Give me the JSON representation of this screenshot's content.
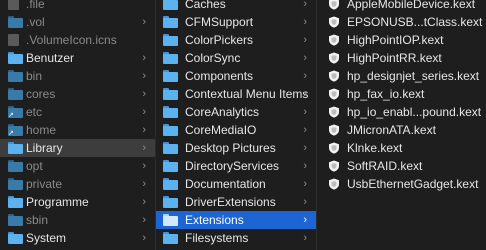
{
  "column1": [
    {
      "label": ".file",
      "dim": true,
      "icon": "document-icon",
      "chevron": false
    },
    {
      "label": ".vol",
      "dim": true,
      "icon": "folder-icon",
      "chevron": true
    },
    {
      "label": ".VolumeIcon.icns",
      "dim": true,
      "icon": "document-icon",
      "chevron": false
    },
    {
      "label": "Benutzer",
      "dim": false,
      "icon": "folder-icon",
      "chevron": true
    },
    {
      "label": "bin",
      "dim": true,
      "icon": "folder-icon",
      "chevron": true
    },
    {
      "label": "cores",
      "dim": true,
      "icon": "folder-icon",
      "chevron": true
    },
    {
      "label": "etc",
      "dim": true,
      "icon": "alias-folder-icon",
      "chevron": true
    },
    {
      "label": "home",
      "dim": true,
      "icon": "alias-folder-icon",
      "chevron": true
    },
    {
      "label": "Library",
      "dim": false,
      "icon": "folder-icon",
      "chevron": true,
      "selected": true
    },
    {
      "label": "opt",
      "dim": true,
      "icon": "folder-icon",
      "chevron": true
    },
    {
      "label": "private",
      "dim": true,
      "icon": "folder-icon",
      "chevron": true
    },
    {
      "label": "Programme",
      "dim": false,
      "icon": "folder-icon",
      "chevron": true
    },
    {
      "label": "sbin",
      "dim": true,
      "icon": "folder-icon",
      "chevron": true
    },
    {
      "label": "System",
      "dim": false,
      "icon": "folder-icon",
      "chevron": true
    }
  ],
  "column2": [
    "Caches",
    "CFMSupport",
    "ColorPickers",
    "ColorSync",
    "Components",
    "Contextual Menu Items",
    "CoreAnalytics",
    "CoreMediaIO",
    "Desktop Pictures",
    "DirectoryServices",
    "Documentation",
    "DriverExtensions",
    "Extensions",
    "Filesystems"
  ],
  "column2_selected": "Extensions",
  "column3": [
    "AppleMobileDevice.kext",
    "EPSONUSB...tClass.kext",
    "HighPointIOP.kext",
    "HighPointRR.kext",
    "hp_designjet_series.kext",
    "hp_fax_io.kext",
    "hp_io_enabl...pound.kext",
    "JMicronATA.kext",
    "Klnke.kext",
    "SoftRAID.kext",
    "UsbEthernetGadget.kext"
  ],
  "chevron_glyph": "›",
  "colors": {
    "background": "#1e1e1e",
    "folder": "#5cb2ee",
    "selection_active": "#1c65d3",
    "selection_inactive": "#3d3d3d"
  }
}
